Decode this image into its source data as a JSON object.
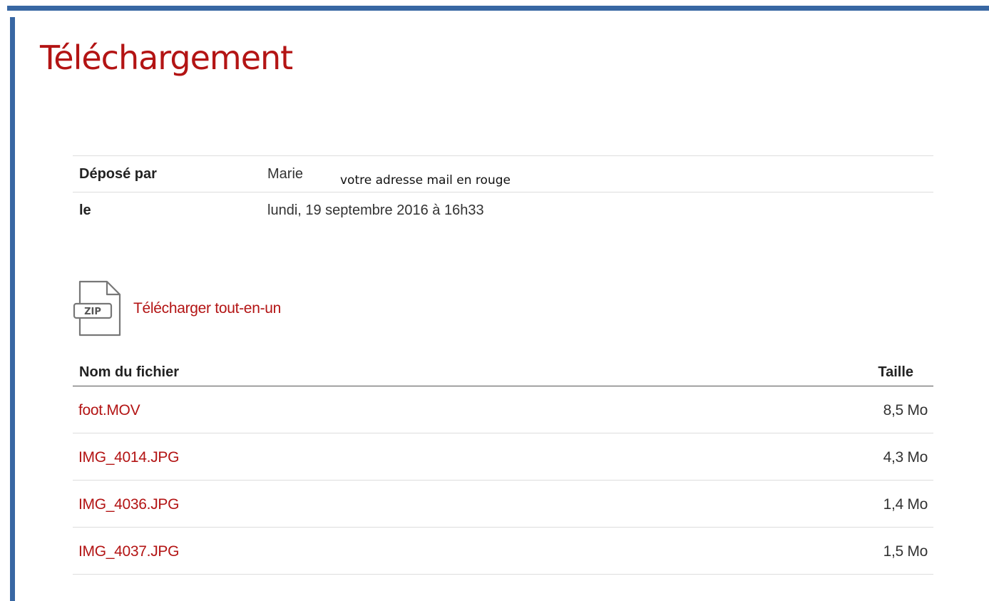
{
  "page": {
    "title": "Téléchargement"
  },
  "info": {
    "deposited_by_label": "Déposé par",
    "deposited_by_value": "Marie",
    "mail_note": "votre adresse mail en rouge",
    "date_label": "le",
    "date_value": "lundi, 19 septembre 2016 à 16h33"
  },
  "zip": {
    "icon_text": "ZIP",
    "icon": "zip-file-icon",
    "label": "Télécharger tout-en-un"
  },
  "files": {
    "header_name": "Nom du fichier",
    "header_size": "Taille",
    "rows": [
      {
        "name": "foot.MOV",
        "size": "8,5 Mo"
      },
      {
        "name": "IMG_4014.JPG",
        "size": "4,3 Mo"
      },
      {
        "name": "IMG_4036.JPG",
        "size": "1,4 Mo"
      },
      {
        "name": "IMG_4037.JPG",
        "size": "1,5 Mo"
      }
    ]
  },
  "colors": {
    "accent_red": "#b31414",
    "frame_blue": "#3867a3"
  }
}
